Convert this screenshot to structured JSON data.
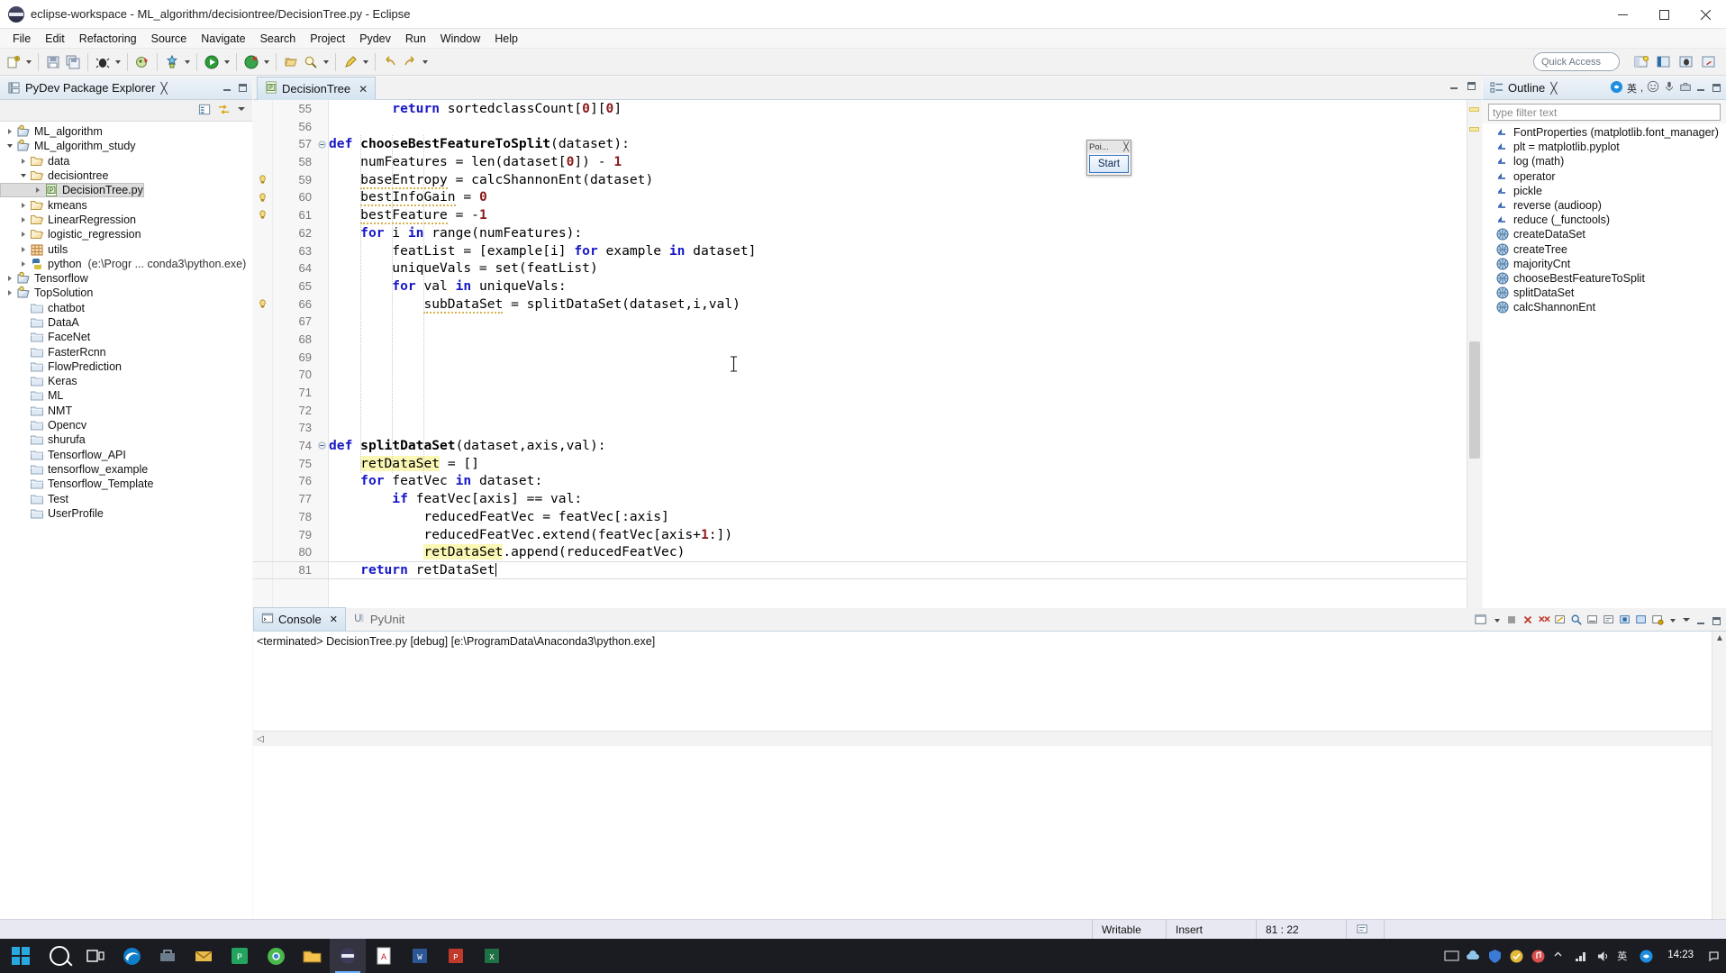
{
  "window": {
    "title": "eclipse-workspace - ML_algorithm/decisiontree/DecisionTree.py - Eclipse",
    "minimize_label": "Minimize",
    "maximize_label": "Maximize",
    "close_label": "Close"
  },
  "menubar": {
    "items": [
      "File",
      "Edit",
      "Refactoring",
      "Source",
      "Navigate",
      "Search",
      "Project",
      "Pydev",
      "Run",
      "Window",
      "Help"
    ]
  },
  "toolbar": {
    "quick_access_placeholder": "Quick Access",
    "icons": [
      "new-wizard-icon",
      "save-icon",
      "save-all-icon",
      "debug-icon",
      "run-icon",
      "run-external-tools-icon",
      "new-python-project-icon",
      "open-type-icon",
      "pydev-package-icon",
      "search-icon",
      "last-edit-icon",
      "back-icon",
      "forward-icon"
    ]
  },
  "package_explorer": {
    "title": "PyDev Package Explorer",
    "close_label": "Close",
    "tools": [
      "collapse-all-icon",
      "link-with-editor-icon",
      "view-menu-icon"
    ],
    "tree": [
      {
        "label": "ML_algorithm",
        "icon": "python-project-icon",
        "indent": 0,
        "twisty": "right"
      },
      {
        "label": "ML_algorithm_study",
        "icon": "python-project-icon",
        "indent": 0,
        "twisty": "down"
      },
      {
        "label": "data",
        "icon": "folder-icon",
        "indent": 1,
        "twisty": "right"
      },
      {
        "label": "decisiontree",
        "icon": "folder-icon",
        "indent": 1,
        "twisty": "down"
      },
      {
        "label": "DecisionTree.py",
        "icon": "python-file-icon",
        "indent": 2,
        "twisty": "right",
        "selected": true
      },
      {
        "label": "kmeans",
        "icon": "folder-icon",
        "indent": 1,
        "twisty": "right"
      },
      {
        "label": "LinearRegression",
        "icon": "folder-icon",
        "indent": 1,
        "twisty": "right"
      },
      {
        "label": "logistic_regression",
        "icon": "folder-icon",
        "indent": 1,
        "twisty": "right"
      },
      {
        "label": "utils",
        "icon": "grid-folder-icon",
        "indent": 1,
        "twisty": "right"
      },
      {
        "label": "python",
        "sublabel": "(e:\\Progr ... conda3\\python.exe)",
        "icon": "python-interpreter-icon",
        "indent": 1,
        "twisty": "right"
      },
      {
        "label": "Tensorflow",
        "icon": "python-project-icon",
        "indent": 0,
        "twisty": "right"
      },
      {
        "label": "TopSolution",
        "icon": "python-project-icon",
        "indent": 0,
        "twisty": "right"
      },
      {
        "label": "chatbot",
        "icon": "closed-folder-icon",
        "indent": 1,
        "twisty": "none"
      },
      {
        "label": "DataA",
        "icon": "closed-folder-icon",
        "indent": 1,
        "twisty": "none"
      },
      {
        "label": "FaceNet",
        "icon": "closed-folder-icon",
        "indent": 1,
        "twisty": "none"
      },
      {
        "label": "FasterRcnn",
        "icon": "closed-folder-icon",
        "indent": 1,
        "twisty": "none"
      },
      {
        "label": "FlowPrediction",
        "icon": "closed-folder-icon",
        "indent": 1,
        "twisty": "none"
      },
      {
        "label": "Keras",
        "icon": "closed-folder-icon",
        "indent": 1,
        "twisty": "none"
      },
      {
        "label": "ML",
        "icon": "closed-folder-icon",
        "indent": 1,
        "twisty": "none"
      },
      {
        "label": "NMT",
        "icon": "closed-folder-icon",
        "indent": 1,
        "twisty": "none"
      },
      {
        "label": "Opencv",
        "icon": "closed-folder-icon",
        "indent": 1,
        "twisty": "none"
      },
      {
        "label": "shurufa",
        "icon": "closed-folder-icon",
        "indent": 1,
        "twisty": "none"
      },
      {
        "label": "Tensorflow_API",
        "icon": "closed-folder-icon",
        "indent": 1,
        "twisty": "none"
      },
      {
        "label": "tensorflow_example",
        "icon": "closed-folder-icon",
        "indent": 1,
        "twisty": "none"
      },
      {
        "label": "Tensorflow_Template",
        "icon": "closed-folder-icon",
        "indent": 1,
        "twisty": "none"
      },
      {
        "label": "Test",
        "icon": "closed-folder-icon",
        "indent": 1,
        "twisty": "none"
      },
      {
        "label": "UserProfile",
        "icon": "closed-folder-icon",
        "indent": 1,
        "twisty": "none"
      }
    ]
  },
  "editor": {
    "tab_label": "DecisionTree",
    "tab_close": "✕",
    "lines": [
      {
        "n": 55,
        "warn": false,
        "fold": false,
        "indent": 2,
        "tokens": [
          {
            "t": "        ",
            "c": ""
          },
          {
            "t": "return",
            "c": "kw"
          },
          {
            "t": " sortedclassCount[",
            "c": ""
          },
          {
            "t": "0",
            "c": "num"
          },
          {
            "t": "][",
            "c": ""
          },
          {
            "t": "0",
            "c": "num"
          },
          {
            "t": "]",
            "c": ""
          }
        ]
      },
      {
        "n": 56,
        "warn": false,
        "fold": false,
        "indent": 0,
        "tokens": []
      },
      {
        "n": 57,
        "warn": false,
        "fold": true,
        "indent": 0,
        "tokens": [
          {
            "t": "def ",
            "c": "kw"
          },
          {
            "t": "chooseBestFeatureToSplit",
            "c": "fn"
          },
          {
            "t": "(dataset):",
            "c": ""
          }
        ]
      },
      {
        "n": 58,
        "warn": false,
        "fold": false,
        "indent": 1,
        "tokens": [
          {
            "t": "    numFeatures = len(dataset[",
            "c": ""
          },
          {
            "t": "0",
            "c": "num"
          },
          {
            "t": "]) - ",
            "c": ""
          },
          {
            "t": "1",
            "c": "num"
          }
        ]
      },
      {
        "n": 59,
        "warn": true,
        "fold": false,
        "indent": 1,
        "tokens": [
          {
            "t": "    ",
            "c": ""
          },
          {
            "t": "baseEntropy",
            "c": "warnul"
          },
          {
            "t": " = calcShannonEnt(dataset)",
            "c": ""
          }
        ]
      },
      {
        "n": 60,
        "warn": true,
        "fold": false,
        "indent": 1,
        "tokens": [
          {
            "t": "    ",
            "c": ""
          },
          {
            "t": "bestInfoGain",
            "c": "warnul"
          },
          {
            "t": " = ",
            "c": ""
          },
          {
            "t": "0",
            "c": "num"
          }
        ]
      },
      {
        "n": 61,
        "warn": true,
        "fold": false,
        "indent": 1,
        "tokens": [
          {
            "t": "    ",
            "c": ""
          },
          {
            "t": "bestFeature",
            "c": "warnul"
          },
          {
            "t": " = -",
            "c": ""
          },
          {
            "t": "1",
            "c": "num"
          }
        ]
      },
      {
        "n": 62,
        "warn": false,
        "fold": false,
        "indent": 1,
        "tokens": [
          {
            "t": "    ",
            "c": ""
          },
          {
            "t": "for",
            "c": "kw"
          },
          {
            "t": " i ",
            "c": ""
          },
          {
            "t": "in",
            "c": "kw"
          },
          {
            "t": " range(numFeatures):",
            "c": ""
          }
        ]
      },
      {
        "n": 63,
        "warn": false,
        "fold": false,
        "indent": 2,
        "tokens": [
          {
            "t": "        featList = [example[i] ",
            "c": ""
          },
          {
            "t": "for",
            "c": "kw"
          },
          {
            "t": " example ",
            "c": ""
          },
          {
            "t": "in",
            "c": "kw"
          },
          {
            "t": " dataset]",
            "c": ""
          }
        ]
      },
      {
        "n": 64,
        "warn": false,
        "fold": false,
        "indent": 2,
        "tokens": [
          {
            "t": "        uniqueVals = set(featList)",
            "c": ""
          }
        ]
      },
      {
        "n": 65,
        "warn": false,
        "fold": false,
        "indent": 2,
        "tokens": [
          {
            "t": "        ",
            "c": ""
          },
          {
            "t": "for",
            "c": "kw"
          },
          {
            "t": " val ",
            "c": ""
          },
          {
            "t": "in",
            "c": "kw"
          },
          {
            "t": " uniqueVals:",
            "c": ""
          }
        ]
      },
      {
        "n": 66,
        "warn": true,
        "fold": false,
        "indent": 3,
        "tokens": [
          {
            "t": "            ",
            "c": ""
          },
          {
            "t": "subDataSet",
            "c": "warnul"
          },
          {
            "t": " = splitDataSet(dataset,i,val)",
            "c": ""
          }
        ]
      },
      {
        "n": 67,
        "warn": false,
        "fold": false,
        "indent": 3,
        "tokens": []
      },
      {
        "n": 68,
        "warn": false,
        "fold": false,
        "indent": 3,
        "tokens": []
      },
      {
        "n": 69,
        "warn": false,
        "fold": false,
        "indent": 3,
        "tokens": []
      },
      {
        "n": 70,
        "warn": false,
        "fold": false,
        "indent": 3,
        "tokens": []
      },
      {
        "n": 71,
        "warn": false,
        "fold": false,
        "indent": 3,
        "tokens": []
      },
      {
        "n": 72,
        "warn": false,
        "fold": false,
        "indent": 3,
        "tokens": []
      },
      {
        "n": 73,
        "warn": false,
        "fold": false,
        "indent": 3,
        "tokens": []
      },
      {
        "n": 74,
        "warn": false,
        "fold": true,
        "indent": 0,
        "tokens": [
          {
            "t": "def ",
            "c": "kw"
          },
          {
            "t": "splitDataSet",
            "c": "fn"
          },
          {
            "t": "(dataset,axis,val):",
            "c": ""
          }
        ]
      },
      {
        "n": 75,
        "warn": false,
        "fold": false,
        "indent": 1,
        "tokens": [
          {
            "t": "    ",
            "c": ""
          },
          {
            "t": "retDataSet",
            "c": "hl"
          },
          {
            "t": " = []",
            "c": ""
          }
        ]
      },
      {
        "n": 76,
        "warn": false,
        "fold": false,
        "indent": 1,
        "tokens": [
          {
            "t": "    ",
            "c": ""
          },
          {
            "t": "for",
            "c": "kw"
          },
          {
            "t": " featVec ",
            "c": ""
          },
          {
            "t": "in",
            "c": "kw"
          },
          {
            "t": " dataset:",
            "c": ""
          }
        ]
      },
      {
        "n": 77,
        "warn": false,
        "fold": false,
        "indent": 2,
        "tokens": [
          {
            "t": "        ",
            "c": ""
          },
          {
            "t": "if",
            "c": "kw"
          },
          {
            "t": " featVec[axis] == val:",
            "c": ""
          }
        ]
      },
      {
        "n": 78,
        "warn": false,
        "fold": false,
        "indent": 3,
        "tokens": [
          {
            "t": "            reducedFeatVec = featVec[:axis]",
            "c": ""
          }
        ]
      },
      {
        "n": 79,
        "warn": false,
        "fold": false,
        "indent": 3,
        "tokens": [
          {
            "t": "            reducedFeatVec.extend(featVec[axis+",
            "c": ""
          },
          {
            "t": "1",
            "c": "num"
          },
          {
            "t": ":])",
            "c": ""
          }
        ]
      },
      {
        "n": 80,
        "warn": false,
        "fold": false,
        "indent": 3,
        "tokens": [
          {
            "t": "            ",
            "c": ""
          },
          {
            "t": "retDataSet",
            "c": "hl"
          },
          {
            "t": ".append(reducedFeatVec)",
            "c": ""
          }
        ]
      },
      {
        "n": 81,
        "warn": false,
        "fold": false,
        "indent": 1,
        "tokens": [
          {
            "t": "    ",
            "c": ""
          },
          {
            "t": "return",
            "c": "kw"
          },
          {
            "t": " retDataSet",
            "c": ""
          }
        ]
      }
    ]
  },
  "outline": {
    "title": "Outline",
    "close_label": "Close",
    "filter_placeholder": "type filter text",
    "items": [
      {
        "label": "FontProperties (matplotlib.font_manager)",
        "icon": "import-icon"
      },
      {
        "label": "plt = matplotlib.pyplot",
        "icon": "import-icon"
      },
      {
        "label": "log (math)",
        "icon": "import-icon"
      },
      {
        "label": "operator",
        "icon": "import-icon"
      },
      {
        "label": "pickle",
        "icon": "import-icon"
      },
      {
        "label": "reverse (audioop)",
        "icon": "import-icon"
      },
      {
        "label": "reduce (_functools)",
        "icon": "import-icon"
      },
      {
        "label": "createDataSet",
        "icon": "function-icon"
      },
      {
        "label": "createTree",
        "icon": "function-icon"
      },
      {
        "label": "majorityCnt",
        "icon": "function-icon"
      },
      {
        "label": "chooseBestFeatureToSplit",
        "icon": "function-icon"
      },
      {
        "label": "splitDataSet",
        "icon": "function-icon"
      },
      {
        "label": "calcShannonEnt",
        "icon": "function-icon"
      }
    ]
  },
  "float_palette": {
    "title": "Poi...",
    "button_label": "Start"
  },
  "console": {
    "tabs": [
      {
        "label": "Console",
        "active": true,
        "icon": "console-icon",
        "close": "✕"
      },
      {
        "label": "PyUnit",
        "active": false,
        "icon": "pyunit-icon"
      }
    ],
    "terminated_line": "<terminated> DecisionTree.py [debug] [e:\\ProgramData\\Anaconda3\\python.exe]",
    "prompt": ">>>",
    "tools": [
      "terminate-icon",
      "remove-launch-icon",
      "remove-all-icon",
      "clear-console-icon",
      "scroll-lock-icon",
      "pin-console-icon",
      "display-selected-icon",
      "open-console-icon",
      "minimize-icon",
      "maximize-icon"
    ]
  },
  "statusbar": {
    "writable": "Writable",
    "insert_mode": "Insert",
    "cursor_position": "81 : 22"
  },
  "taskbar": {
    "start_label": "start-icon",
    "items": [
      "search-icon",
      "task-view-icon",
      "edge-icon",
      "tools-icon",
      "mail-icon",
      "pycharm-icon",
      "chrome-icon",
      "explorer-icon",
      "eclipse-icon",
      "pdf-icon",
      "word-icon",
      "ppt-icon",
      "excel-icon"
    ],
    "clock_time": "14:23",
    "tray_items": [
      "keyboard-icon",
      "volume-icon",
      "network-icon",
      "ime-icon",
      "battery-icon",
      "notify-icon"
    ]
  },
  "colors": {
    "accent_blue": "#1717c7",
    "number_red": "#8b1a1a",
    "highlight_yellow": "#fbf7b5",
    "tab_blue": "#d4e4f1",
    "status_bg": "#e8e8f2",
    "taskbar_bg": "#1b1b22",
    "prompt_green": "#22a822"
  }
}
